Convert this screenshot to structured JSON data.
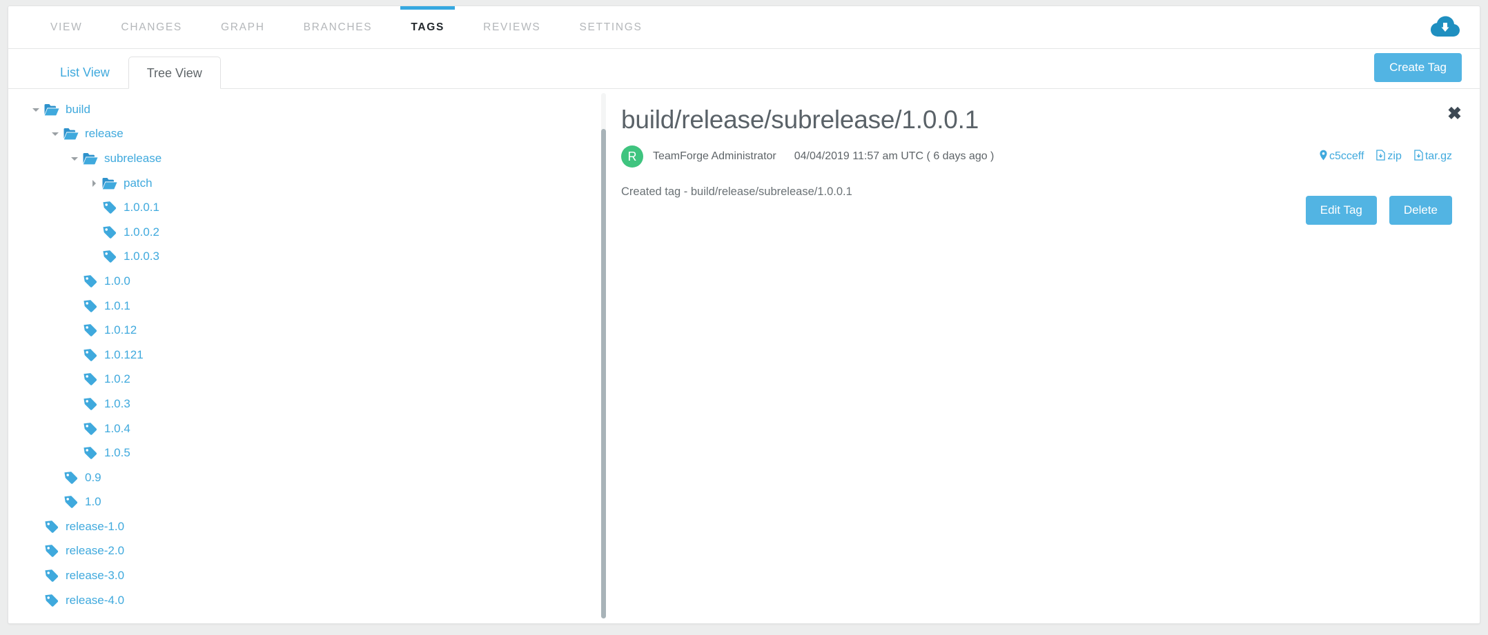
{
  "nav": {
    "tabs": [
      {
        "label": "VIEW",
        "active": false
      },
      {
        "label": "CHANGES",
        "active": false
      },
      {
        "label": "GRAPH",
        "active": false
      },
      {
        "label": "BRANCHES",
        "active": false
      },
      {
        "label": "TAGS",
        "active": true
      },
      {
        "label": "REVIEWS",
        "active": false
      },
      {
        "label": "SETTINGS",
        "active": false
      }
    ],
    "download_icon": "cloud-download-icon"
  },
  "subtabs": {
    "items": [
      {
        "label": "List View",
        "active": false
      },
      {
        "label": "Tree View",
        "active": true
      }
    ],
    "create_tag_label": "Create Tag"
  },
  "tree": {
    "nodes": [
      {
        "label": "build",
        "type": "folder",
        "depth": 0,
        "expanded": true
      },
      {
        "label": "release",
        "type": "folder",
        "depth": 1,
        "expanded": true
      },
      {
        "label": "subrelease",
        "type": "folder",
        "depth": 2,
        "expanded": true
      },
      {
        "label": "patch",
        "type": "folder",
        "depth": 3,
        "expanded": false
      },
      {
        "label": "1.0.0.1",
        "type": "tag",
        "depth": 3
      },
      {
        "label": "1.0.0.2",
        "type": "tag",
        "depth": 3
      },
      {
        "label": "1.0.0.3",
        "type": "tag",
        "depth": 3
      },
      {
        "label": "1.0.0",
        "type": "tag",
        "depth": 2
      },
      {
        "label": "1.0.1",
        "type": "tag",
        "depth": 2
      },
      {
        "label": "1.0.12",
        "type": "tag",
        "depth": 2
      },
      {
        "label": "1.0.121",
        "type": "tag",
        "depth": 2
      },
      {
        "label": "1.0.2",
        "type": "tag",
        "depth": 2
      },
      {
        "label": "1.0.3",
        "type": "tag",
        "depth": 2
      },
      {
        "label": "1.0.4",
        "type": "tag",
        "depth": 2
      },
      {
        "label": "1.0.5",
        "type": "tag",
        "depth": 2
      },
      {
        "label": "0.9",
        "type": "tag",
        "depth": 1
      },
      {
        "label": "1.0",
        "type": "tag",
        "depth": 1
      },
      {
        "label": "release-1.0",
        "type": "tag",
        "depth": 0
      },
      {
        "label": "release-2.0",
        "type": "tag",
        "depth": 0
      },
      {
        "label": "release-3.0",
        "type": "tag",
        "depth": 0
      },
      {
        "label": "release-4.0",
        "type": "tag",
        "depth": 0
      }
    ]
  },
  "detail": {
    "title": "build/release/subrelease/1.0.0.1",
    "close_label": "✖",
    "avatar_initial": "R",
    "author": "TeamForge Administrator",
    "date": "04/04/2019 11:57 am UTC ( 6 days ago )",
    "commit_hash": "c5cceff",
    "download_zip": "zip",
    "download_targz": "tar.gz",
    "message": "Created tag - build/release/subrelease/1.0.0.1",
    "edit_label": "Edit Tag",
    "delete_label": "Delete"
  },
  "colors": {
    "accent_blue": "#3fa9dd",
    "button_blue": "#52b4e3",
    "tab_indicator": "#36a8e0",
    "avatar_green": "#3fc47f",
    "cloud_blue": "#1f8fc0",
    "page_bg": "#eceded"
  }
}
